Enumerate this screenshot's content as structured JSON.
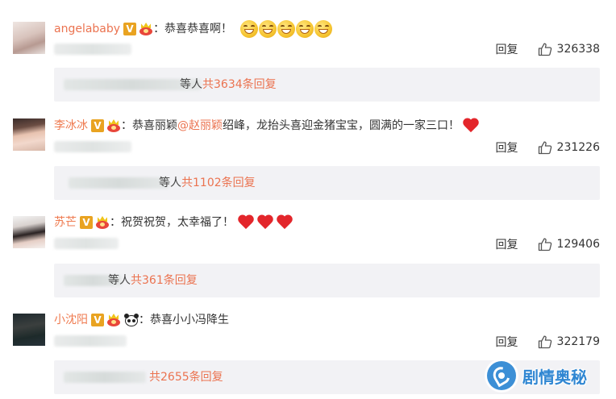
{
  "comments": [
    {
      "username": "angelababy",
      "badge_v": "V",
      "text": "：恭喜恭喜啊！",
      "emoji_count": 5,
      "reply_label": "回复",
      "likes": "326338",
      "replies_who": "等人",
      "replies_count": "共3634条回复"
    },
    {
      "username": "李冰冰",
      "badge_v": "V",
      "text_before": "：恭喜丽颖",
      "mention": "@赵丽颖",
      "text_after": " 绍峰，龙抬头喜迎金猪宝宝，圆满的一家三口！",
      "reply_label": "回复",
      "likes": "231226",
      "replies_who": "等人",
      "replies_count": "共1102条回复"
    },
    {
      "username": "苏芒",
      "badge_v": "V",
      "text": "：祝贺祝贺，太幸福了！",
      "reply_label": "回复",
      "likes": "129406",
      "replies_who": "等人",
      "replies_count": "共361条回复"
    },
    {
      "username": "小沈阳",
      "badge_v": "V",
      "text": "：恭喜小小冯降生",
      "reply_label": "回复",
      "likes": "322179",
      "replies_count": "共2655条回复"
    }
  ],
  "watermark": {
    "text": "剧情奥秘"
  },
  "colors": {
    "username": "#eb7350",
    "reply_box_bg": "#f2f2f5",
    "heart": "#e3262b",
    "v_badge": "#e9a321"
  }
}
